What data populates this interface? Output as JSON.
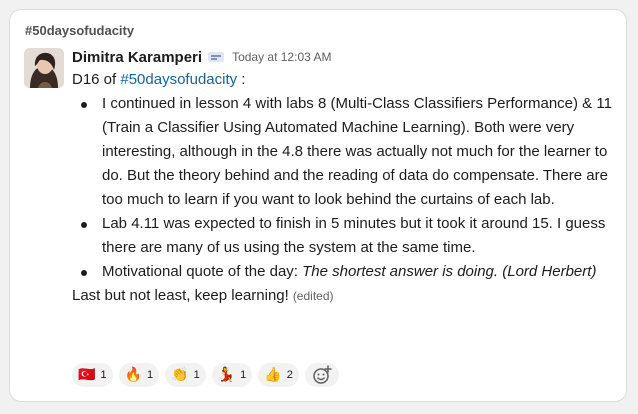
{
  "channel": "#50daysofudacity",
  "message": {
    "author": "Dimitra Karamperi",
    "timestamp": "Today at 12:03 AM",
    "intro_prefix": "D16 of ",
    "intro_hashtag": "#50daysofudacity",
    "intro_suffix": " :",
    "items": [
      {
        "text": "I continued in lesson 4 with labs 8 (Multi-Class Classifiers Performance) & 11 (Train a Classifier Using Automated Machine Learning). Both were very interesting, although in the 4.8 there was actually not much for the learner to do. But the theory behind and the reading of data do compensate. There are too much to learn if you want to look behind the curtains of each lab."
      },
      {
        "text": "Lab 4.11 was expected to finish in 5 minutes but it took it around 15. I guess there are many of us using the system at the same time."
      },
      {
        "text": "Motivational quote of the day: ",
        "quote": "The shortest answer is doing. (Lord Herbert)"
      }
    ],
    "closing": "Last but not least, keep learning!",
    "edited_label": "(edited)"
  },
  "reactions": [
    {
      "emoji": "🇹🇷",
      "icon": "fez-icon",
      "count": "1"
    },
    {
      "emoji": "🔥",
      "icon": "fire-icon",
      "count": "1"
    },
    {
      "emoji": "👏",
      "icon": "clap-icon",
      "count": "1"
    },
    {
      "emoji": "💃",
      "icon": "dancer-icon",
      "count": "1"
    },
    {
      "emoji": "👍",
      "icon": "thumbs-up-icon",
      "count": "2"
    }
  ],
  "colors": {
    "hashtag": "#1264a3",
    "text": "#1d1c1d",
    "muted": "#616061"
  }
}
